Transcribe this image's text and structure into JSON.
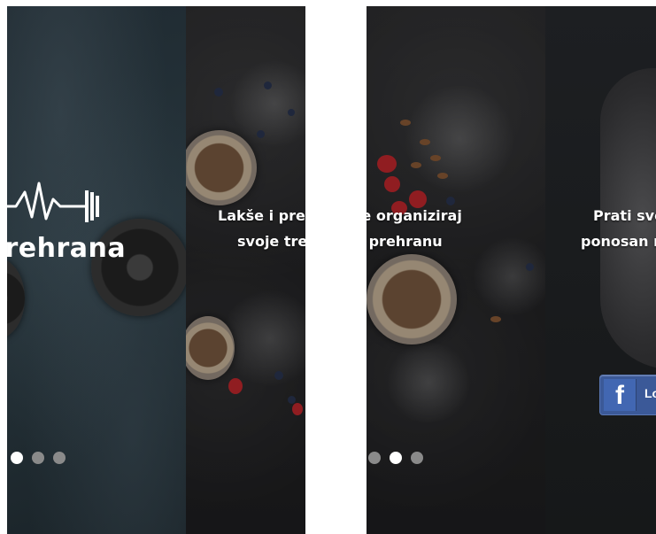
{
  "brand": {
    "logo_text": "s&Prehrana"
  },
  "slides": {
    "slide2_line1": "Lakše i preglednije organiziraj",
    "slide2_line2": "svoje treninge i prehranu",
    "slide3_line1": "Prati svoj napredak i budi",
    "slide3_line2": "ponosan na svoj rezultat"
  },
  "facebook": {
    "icon_letter": "f",
    "label": "Login"
  },
  "pagination": {
    "left_active_index": 0,
    "right_active_index": 1,
    "count": 3
  },
  "colors": {
    "facebook_blue": "#3b5998",
    "dot_active": "#ffffff",
    "dot_inactive": "#8a8a8a"
  }
}
